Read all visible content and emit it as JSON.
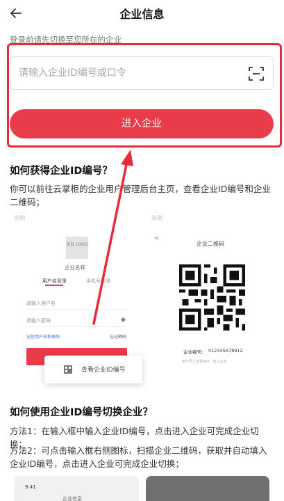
{
  "header": {
    "title": "企业信息"
  },
  "hint": "登录前请先切换至您所在的企业",
  "input": {
    "placeholder": "请输入企业ID编号或口令",
    "value": ""
  },
  "enter_button": "进入企业",
  "section1": {
    "title": "如何获得企业ID编号？",
    "text": "你可以前往云掌柜的企业用户管理后台主页，查看企业ID编号和企业二维码；"
  },
  "example": {
    "left_label": "示例",
    "right_label": "示例",
    "logo_text": "企业 LOGO",
    "company_name": "企业名称",
    "tab_user": "用户名登录",
    "tab_phone": "手机号登录",
    "field_user": "请输入用户名",
    "field_pwd": "请输入密码",
    "remember": "记住用户名和密码",
    "forgot": "忘记密码",
    "popup_text": "查看企业ID编号",
    "qr_title": "企业二维码",
    "qr_id_label": "企业编号：",
    "qr_id_value": "012345678912",
    "qr_footer": "用于员工登录APP　加入企业",
    "qr_arrow": "<"
  },
  "section2": {
    "title": "如何使用企业ID编号切换企业？",
    "method1": "方法1：在输入框中输入企业ID编号，点击进入企业可完成企业切换；",
    "method2": "方法2：可点击输入框右侧图标，扫描企业二维码，获取并自动填入企业ID编号，点击进入企业可完成企业切换；"
  },
  "bottom_example": {
    "time": "9:41",
    "title": "企业信息"
  },
  "colors": {
    "accent": "#ea3b4a",
    "frame": "#ea2a3a"
  }
}
